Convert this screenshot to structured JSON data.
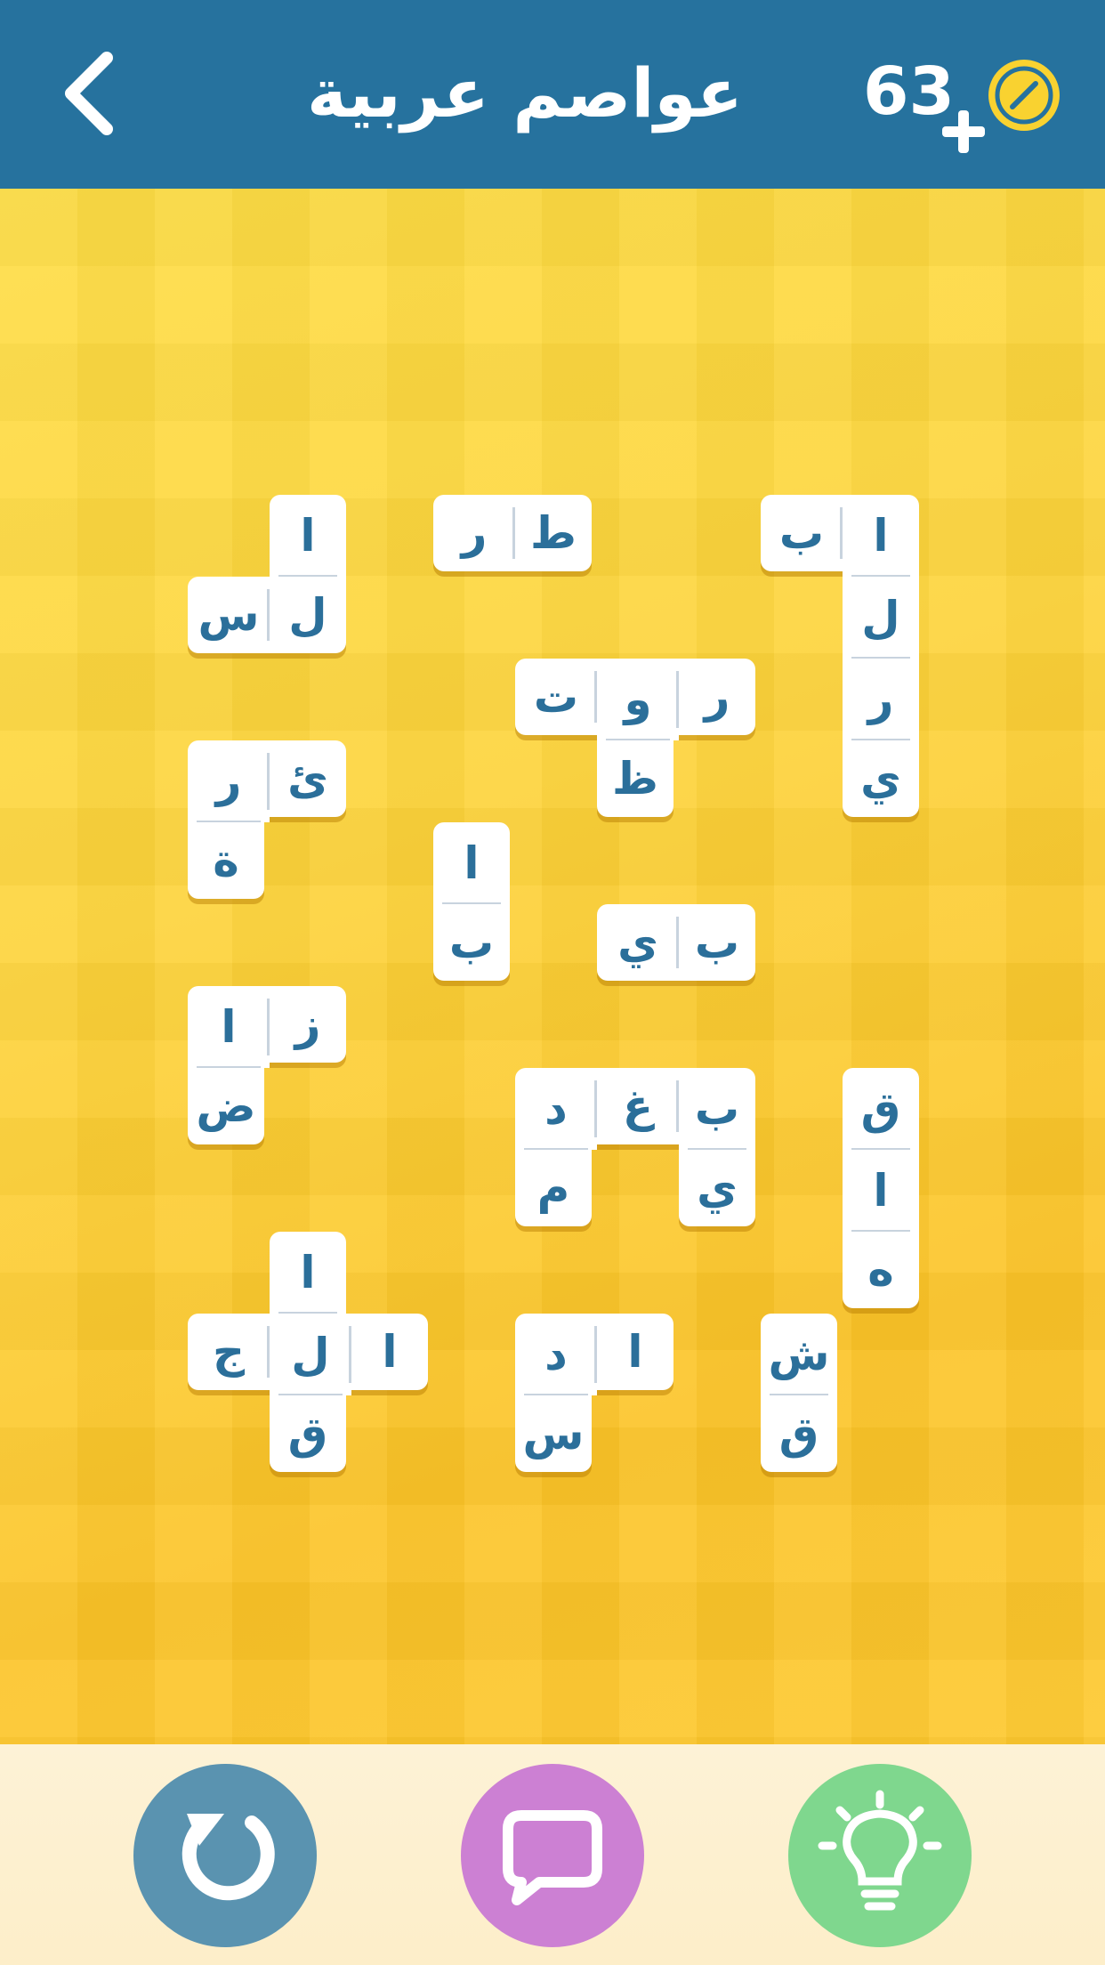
{
  "header": {
    "title": "عواصم عربية",
    "coins": "63"
  },
  "colors": {
    "header_bg": "#26729e",
    "board_yellow": "#fdd33a",
    "tile_text": "#2b6f9a",
    "restart": "#5a93b0",
    "chat": "#cc80d3",
    "hint": "#7fd78e"
  },
  "footer": {
    "icons": [
      "restart-icon",
      "chat-icon",
      "hint-lightbulb-icon"
    ]
  },
  "tiles": [
    {
      "col": 1,
      "row": 0,
      "letter": "ا"
    },
    {
      "col": 0,
      "row": 1,
      "letter": "س"
    },
    {
      "col": 1,
      "row": 1,
      "letter": "ل"
    },
    {
      "col": 3,
      "row": 0,
      "letter": "ر"
    },
    {
      "col": 4,
      "row": 0,
      "letter": "ط"
    },
    {
      "col": 7,
      "row": 0,
      "letter": "ب"
    },
    {
      "col": 8,
      "row": 0,
      "letter": "ا"
    },
    {
      "col": 8,
      "row": 1,
      "letter": "ل"
    },
    {
      "col": 8,
      "row": 2,
      "letter": "ر"
    },
    {
      "col": 8,
      "row": 3,
      "letter": "ي"
    },
    {
      "col": 4,
      "row": 2,
      "letter": "ت"
    },
    {
      "col": 5,
      "row": 2,
      "letter": "و"
    },
    {
      "col": 6,
      "row": 2,
      "letter": "ر"
    },
    {
      "col": 5,
      "row": 3,
      "letter": "ظ"
    },
    {
      "col": 0,
      "row": 3,
      "letter": "ر"
    },
    {
      "col": 1,
      "row": 3,
      "letter": "ئ"
    },
    {
      "col": 0,
      "row": 4,
      "letter": "ة"
    },
    {
      "col": 3,
      "row": 4,
      "letter": "ا"
    },
    {
      "col": 3,
      "row": 5,
      "letter": "ب"
    },
    {
      "col": 5,
      "row": 5,
      "letter": "ي"
    },
    {
      "col": 6,
      "row": 5,
      "letter": "ب"
    },
    {
      "col": 0,
      "row": 6,
      "letter": "ا"
    },
    {
      "col": 1,
      "row": 6,
      "letter": "ز"
    },
    {
      "col": 0,
      "row": 7,
      "letter": "ض"
    },
    {
      "col": 4,
      "row": 7,
      "letter": "د"
    },
    {
      "col": 5,
      "row": 7,
      "letter": "غ"
    },
    {
      "col": 6,
      "row": 7,
      "letter": "ب"
    },
    {
      "col": 4,
      "row": 8,
      "letter": "م"
    },
    {
      "col": 6,
      "row": 8,
      "letter": "ي"
    },
    {
      "col": 8,
      "row": 7,
      "letter": "ق"
    },
    {
      "col": 8,
      "row": 8,
      "letter": "ا"
    },
    {
      "col": 8,
      "row": 9,
      "letter": "ه"
    },
    {
      "col": 1,
      "row": 9,
      "letter": "ا"
    },
    {
      "col": 0,
      "row": 10,
      "letter": "ج"
    },
    {
      "col": 1,
      "row": 10,
      "letter": "ل"
    },
    {
      "col": 2,
      "row": 10,
      "letter": "ا"
    },
    {
      "col": 1,
      "row": 11,
      "letter": "ق"
    },
    {
      "col": 4,
      "row": 10,
      "letter": "د"
    },
    {
      "col": 5,
      "row": 10,
      "letter": "ا"
    },
    {
      "col": 4,
      "row": 11,
      "letter": "س"
    },
    {
      "col": 7,
      "row": 10,
      "letter": "ش"
    },
    {
      "col": 7,
      "row": 11,
      "letter": "ق"
    }
  ]
}
